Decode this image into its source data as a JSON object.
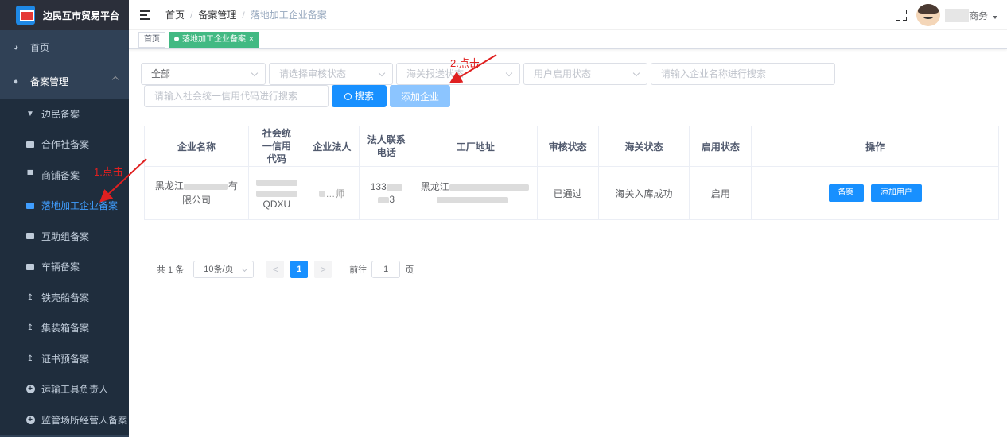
{
  "sidebar": {
    "logo_title": "边民互市贸易平台",
    "items": [
      {
        "label": "首页",
        "icon": "dashboard-icon"
      },
      {
        "label": "备案管理",
        "icon": "user-icon"
      }
    ],
    "sub_items": [
      {
        "label": "边民备案",
        "icon": "stamp-icon"
      },
      {
        "label": "合作社备案",
        "icon": "chart-icon"
      },
      {
        "label": "商铺备案",
        "icon": "shop-icon"
      },
      {
        "label": "落地加工企业备案",
        "icon": "briefcase-icon",
        "active": true
      },
      {
        "label": "互助组备案",
        "icon": "wallet-icon"
      },
      {
        "label": "车辆备案",
        "icon": "chart-icon"
      },
      {
        "label": "铁壳船备案",
        "icon": "upload-icon"
      },
      {
        "label": "集装箱备案",
        "icon": "upload-icon"
      },
      {
        "label": "证书预备案",
        "icon": "upload-icon"
      },
      {
        "label": "运输工具负责人",
        "icon": "plus-circle-icon"
      },
      {
        "label": "监管场所经营人备案",
        "icon": "plus-circle-icon"
      }
    ]
  },
  "navbar": {
    "breadcrumb": [
      "首页",
      "备案管理",
      "落地加工企业备案"
    ],
    "user_name": "商务"
  },
  "tags": {
    "home": "首页",
    "active": "落地加工企业备案"
  },
  "filters": {
    "type_value": "全部",
    "audit_placeholder": "请选择审核状态",
    "customs_placeholder": "海关报送状态",
    "user_status_placeholder": "用户启用状态",
    "company_name_placeholder": "请输入企业名称进行搜索",
    "credit_code_placeholder": "请输入社会统一信用代码进行搜索",
    "search_label": "搜索",
    "add_label": "添加企业"
  },
  "table": {
    "headers": [
      "企业名称",
      "社会统一信用代码",
      "企业法人",
      "法人联系电话",
      "工厂地址",
      "审核状态",
      "海关状态",
      "启用状态",
      "操作"
    ],
    "rows": [
      {
        "company_prefix": "黑龙江",
        "company_mid": "有",
        "company_suffix": "限公司",
        "credit_code_end": "QDXU",
        "legal_person": "…师",
        "phone_prefix": "133",
        "phone_end": "3",
        "address_prefix": "黑龙江",
        "audit_status": "已通过",
        "customs_status": "海关入库成功",
        "enabled_status": "启用",
        "actions": [
          "备案",
          "添加用户"
        ]
      }
    ]
  },
  "pagination": {
    "total": "共 1 条",
    "page_size": "10条/页",
    "current": "1",
    "prev": "<",
    "next": ">",
    "goto_label": "前往",
    "goto_value": "1",
    "page_suffix": "页"
  },
  "annotations": {
    "step1": "1.点击",
    "step2": "2.点击"
  },
  "colors": {
    "sidebar_bg": "#304156",
    "primary": "#1890ff",
    "active_tag": "#42b983",
    "annotation": "#e02020"
  }
}
